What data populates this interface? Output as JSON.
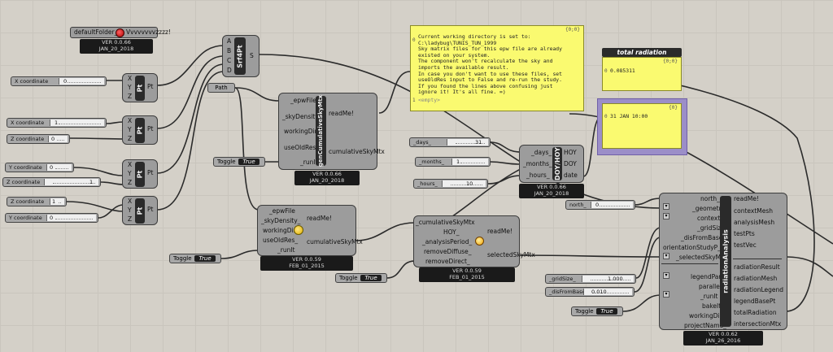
{
  "colors": {
    "canvas": "#d4d0c8",
    "component": "#9c9c9c",
    "panel": "#fafa70",
    "selected_panel_border": "#9b8ec8",
    "wire": "#2b2b2b"
  },
  "path_param": {
    "folder_label": "defaultFolder_",
    "folder_value": "Vvvvvvvvzzzz!",
    "ver": "VER 0.0.66",
    "date": "JAN_20_2018"
  },
  "srf4pt": {
    "inputs": [
      "A",
      "B",
      "C",
      "D"
    ],
    "nickname": "Srf4Pt",
    "output": "S"
  },
  "pt_components": [
    {
      "inputs": [
        "X",
        "Y",
        "Z"
      ],
      "nickname": "Pt",
      "output": "Pt"
    },
    {
      "inputs": [
        "X",
        "Y",
        "Z"
      ],
      "nickname": "Pt",
      "output": "Pt"
    },
    {
      "inputs": [
        "X",
        "Y",
        "Z"
      ],
      "nickname": "Pt",
      "output": "Pt"
    },
    {
      "inputs": [
        "X",
        "Y",
        "Z"
      ],
      "nickname": "Pt",
      "output": "Pt"
    }
  ],
  "sliders": {
    "x1": {
      "label": "X coordinate",
      "value": "0"
    },
    "x2": {
      "label": "X coordinate",
      "value": "1"
    },
    "z2": {
      "label": "Z coordinate",
      "value": "0"
    },
    "y3": {
      "label": "Y coordinate",
      "value": "0"
    },
    "z3": {
      "label": "Z coordinate",
      "value": "1"
    },
    "z4": {
      "label": "Z coordinate",
      "value": "1"
    },
    "y4": {
      "label": "Y coordinate",
      "value": "0"
    },
    "days": {
      "label": "_days_",
      "value": "31"
    },
    "months": {
      "label": "_months_",
      "value": "1"
    },
    "hours": {
      "label": "_hours_",
      "value": "10"
    },
    "north": {
      "label": "north_",
      "value": "0"
    },
    "gridsize": {
      "label": "_gridSize_",
      "value": "1.000"
    },
    "disfrombase": {
      "label": "_disFromBase",
      "value": "0.010"
    }
  },
  "path_label": "Path",
  "toggles": {
    "t1": {
      "label": "Toggle",
      "value": "True"
    },
    "t2": {
      "label": "Toggle",
      "value": "True"
    },
    "t3": {
      "label": "Toggle",
      "value": "True"
    },
    "t4": {
      "label": "Toggle",
      "value": "True"
    }
  },
  "gen_sky_new": {
    "inputs": [
      "_epwFile",
      "_skyDensity_",
      "workingDir_",
      "useOldRes_",
      "_runIt"
    ],
    "nickname": "genCumulativeSkyMtx",
    "outputs": [
      "readMe!",
      "cumulativeSkyMtx"
    ],
    "ver": "VER 0.0.66",
    "date": "JAN_20_2018"
  },
  "gen_sky_old": {
    "inputs": [
      "_epwFile",
      "_skyDensity_",
      "workingDir_",
      "useOldRes_",
      "_runIt"
    ],
    "outputs": [
      "readMe!",
      "cumulativeSkyMtx"
    ],
    "ver": "VER 0.0.59",
    "date": "FEB_01_2015"
  },
  "select_sky": {
    "inputs": [
      "_cumulativeSkyMtx",
      "HOY_",
      "_analysisPeriod_",
      "removeDiffuse_",
      "removeDirect_"
    ],
    "outputs": [
      "readMe!",
      "selectedSkyMtx"
    ],
    "ver": "VER 0.0.59",
    "date": "FEB_01_2015"
  },
  "doy_hoy": {
    "inputs": [
      "_days_",
      "_months_",
      "_hours_"
    ],
    "nickname": "DOY/HOY",
    "outputs": [
      "HOY",
      "DOY",
      "date"
    ],
    "ver": "VER 0.0.66",
    "date": "JAN_20_2018"
  },
  "readme_panel": {
    "index": "{0;0}",
    "lead": "0",
    "text": "Current working directory is set to:\nC:\\ladybug\\TUNIS_TUN_1999\nSky matrix files for this epw file are already\nexisted on your system.\nThe component won't recalculate the sky and\nimports the available result.\nIn case you don't want to use these files, set\nuseOldRes input to False and re-run the study.\nIf you found the lines above confusing just\nignore it! It's all fine. =)",
    "empty": "<empty>",
    "empty_lead": "1"
  },
  "total_radiation_panel": {
    "title": "total radiation",
    "index": "{0;0}",
    "lead": "0",
    "text": "0.085311"
  },
  "date_panel": {
    "index": "{0}",
    "lead": "0",
    "text": "31 JAN 10:00"
  },
  "radiation_analysis": {
    "inputs_top": [
      "north_",
      "_geometry",
      "context_",
      "_gridSize_",
      "_disFromBase",
      "orientationStudyP_",
      "_selectedSkyMtx"
    ],
    "inputs_bottom": [
      "legendPar_",
      "parallel_",
      "_runIt",
      "bakeIt_",
      "workingDir_",
      "projectName_"
    ],
    "nickname": "radiationAnalysis",
    "outputs_top": [
      "readMe!",
      "contextMesh",
      "analysisMesh",
      "testPts",
      "testVec"
    ],
    "outputs_bottom": [
      "radiationResult",
      "radiationMesh",
      "radiationLegend",
      "legendBasePt",
      "totalRadiation",
      "intersectionMtx"
    ],
    "ver": "VER 0.0.62",
    "date": "JAN_26_2016"
  }
}
